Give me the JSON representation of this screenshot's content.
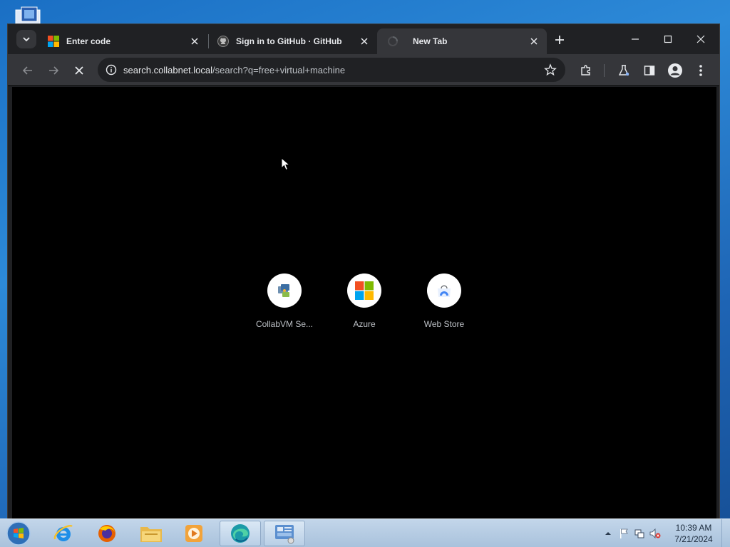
{
  "browser": {
    "tabs": [
      {
        "title": "Enter code",
        "favicon": "microsoft-logo-icon",
        "active": false
      },
      {
        "title": "Sign in to GitHub · GitHub",
        "favicon": "github-icon",
        "active": false
      },
      {
        "title": "New Tab",
        "favicon": "loading-spinner-icon",
        "active": true
      }
    ],
    "url_host": "search.collabnet.local",
    "url_path": "/search?q=free+virtual+machine"
  },
  "new_tab_page": {
    "shortcuts": [
      {
        "label": "CollabVM Se...",
        "icon": "collabvm-icon"
      },
      {
        "label": "Azure",
        "icon": "microsoft-logo-icon"
      },
      {
        "label": "Web Store",
        "icon": "web-store-icon"
      }
    ]
  },
  "taskbar": {
    "apps": [
      "internet-explorer-icon",
      "firefox-icon",
      "file-explorer-icon",
      "media-player-icon",
      "edge-icon",
      "control-panel-icon"
    ],
    "clock_time": "10:39 AM",
    "clock_date": "7/21/2024"
  },
  "colors": {
    "desktop": "#1e64b4",
    "browser_frame": "#202124",
    "toolbar": "#35363a",
    "content": "#000000"
  }
}
